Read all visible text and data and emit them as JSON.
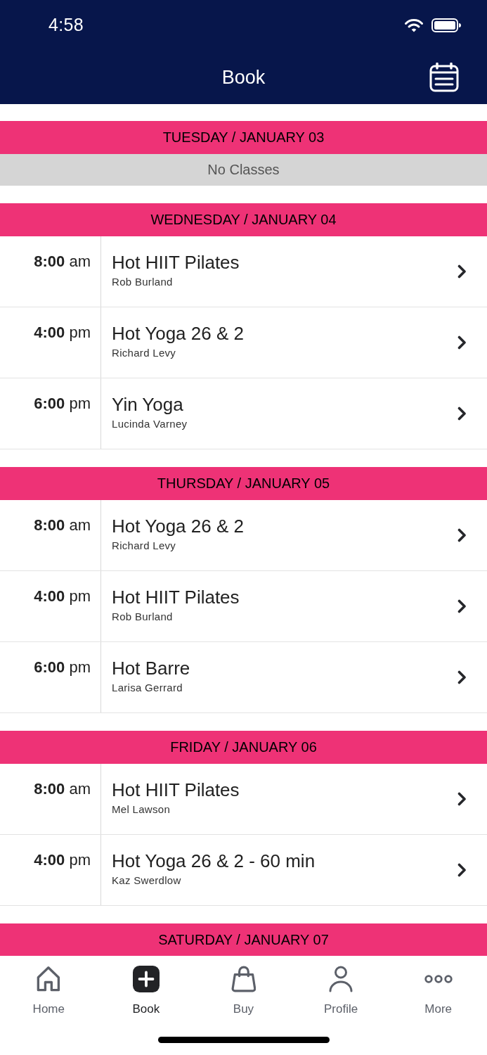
{
  "status_bar": {
    "time": "4:58"
  },
  "nav_bar": {
    "title": "Book"
  },
  "days": [
    {
      "title": "TUESDAY / JANUARY 03",
      "notice": "No Classes"
    },
    {
      "title": "WEDNESDAY / JANUARY 04",
      "classes": [
        {
          "time": "**8:00** am",
          "name": "Hot HIIT Pilates",
          "instructor": "Rob Burland"
        },
        {
          "time": "**4:00** pm",
          "name": "Hot Yoga 26 & 2",
          "instructor": "Richard Levy"
        },
        {
          "time": "**6:00** pm",
          "name": "Yin Yoga",
          "instructor": "Lucinda Varney"
        }
      ]
    },
    {
      "title": "THURSDAY / JANUARY 05",
      "classes": [
        {
          "time": "**8:00** am",
          "name": "Hot Yoga 26 & 2",
          "instructor": "Richard Levy"
        },
        {
          "time": "**4:00** pm",
          "name": "Hot HIIT Pilates",
          "instructor": "Rob Burland"
        },
        {
          "time": "**6:00** pm",
          "name": "Hot Barre",
          "instructor": "Larisa Gerrard"
        }
      ]
    },
    {
      "title": "FRIDAY / JANUARY 06",
      "classes": [
        {
          "time": "**8:00** am",
          "name": "Hot HIIT Pilates",
          "instructor": "Mel Lawson"
        },
        {
          "time": "**4:00** pm",
          "name": "Hot Yoga 26 & 2 - 60 min",
          "instructor": "Kaz Swerdlow"
        }
      ]
    },
    {
      "title": "SATURDAY / JANUARY 07"
    }
  ],
  "tab_bar": [
    {
      "label": "Home",
      "selected": false
    },
    {
      "label": "Book",
      "selected": true
    },
    {
      "label": "Buy",
      "selected": false
    },
    {
      "label": "Profile",
      "selected": false
    },
    {
      "label": "More",
      "selected": false
    }
  ]
}
